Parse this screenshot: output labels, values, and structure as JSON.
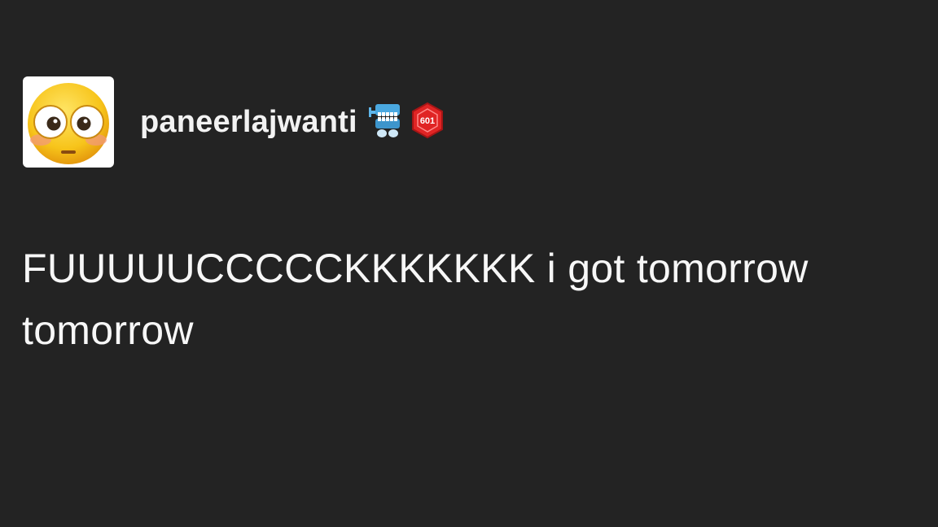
{
  "post": {
    "username": "paneerlajwanti",
    "avatar_icon": "flushed-face-emoji",
    "badges": [
      {
        "icon": "blue-chattering-teeth-icon"
      },
      {
        "icon": "red-d20-dice-badge",
        "label": "601"
      }
    ],
    "text": "FUUUUUCCCCCKKKKKKK i got tomorrow tomorrow"
  },
  "colors": {
    "background": "#232323",
    "text": "#f7f7f7",
    "badge_red": "#e02424",
    "badge_blue": "#4aa8e0"
  }
}
